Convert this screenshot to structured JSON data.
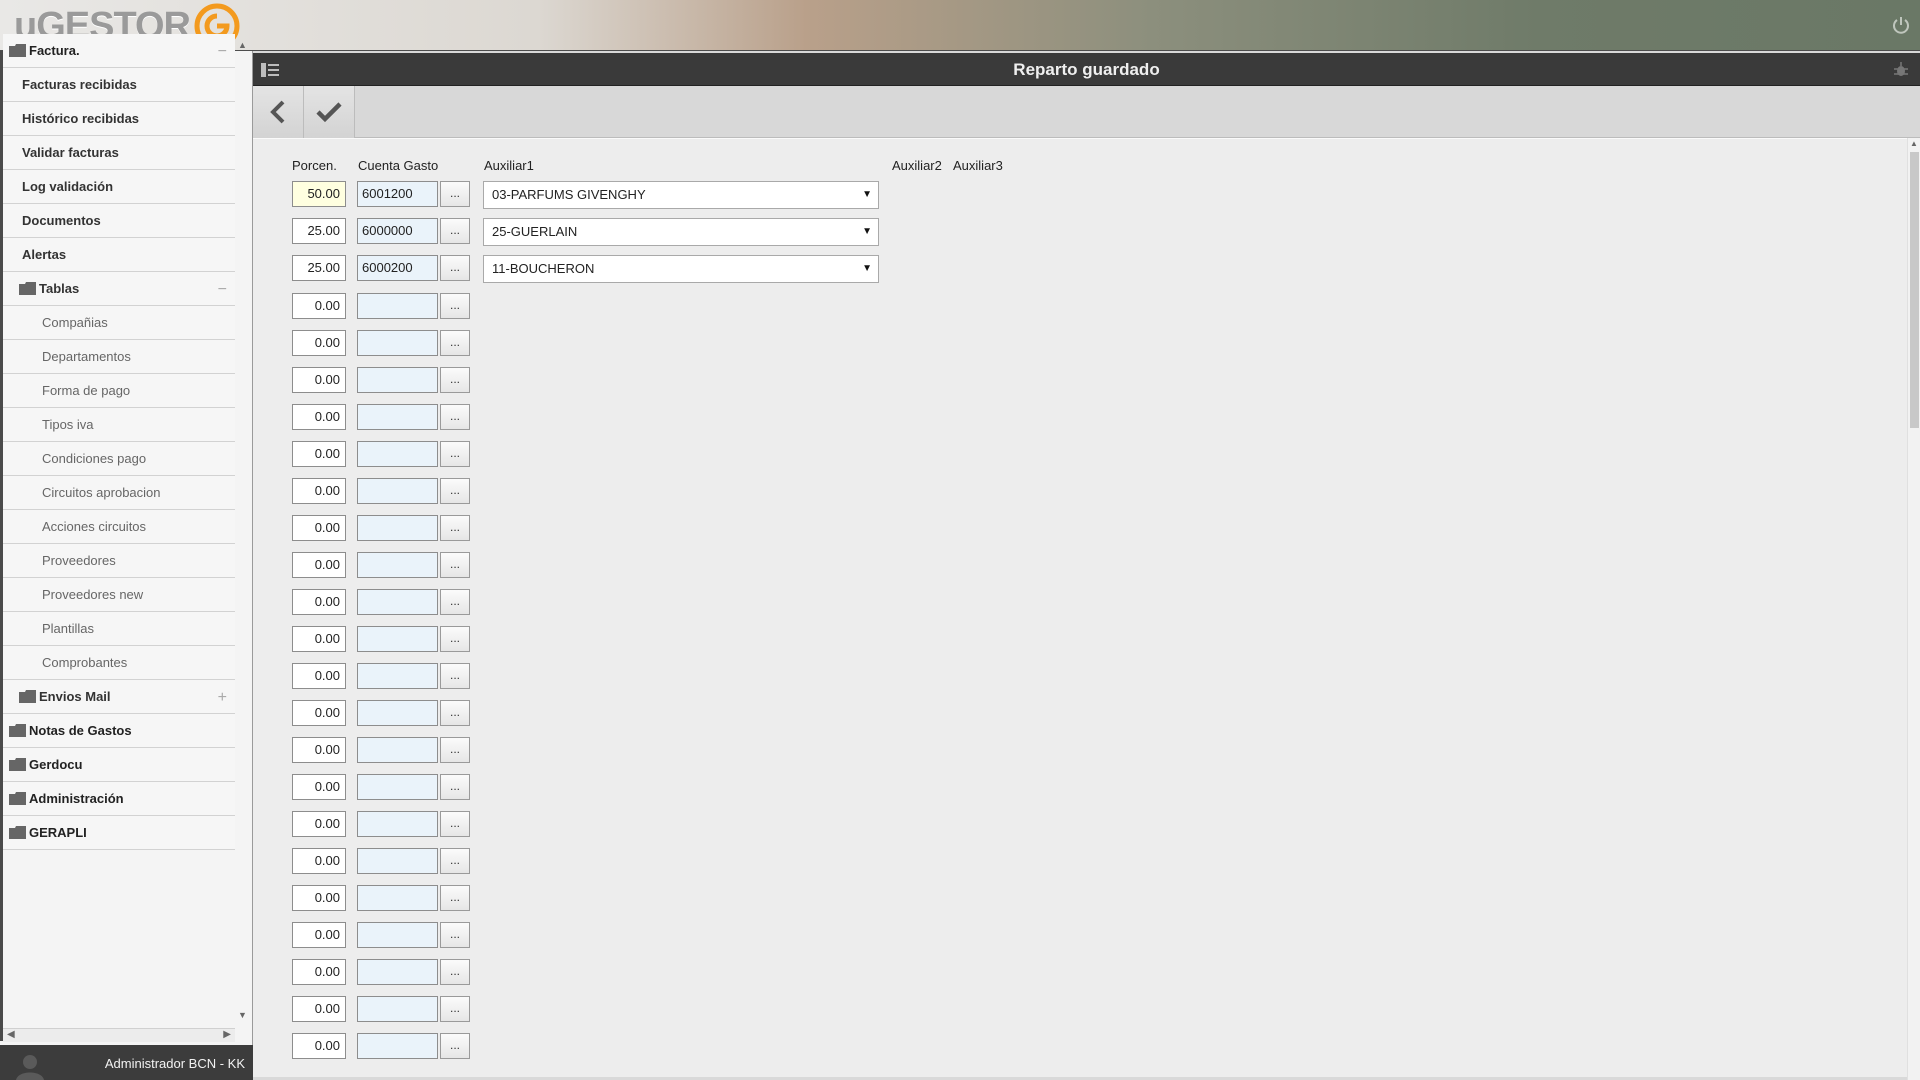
{
  "app": {
    "logo_text": "uGESTOR",
    "user_label": "Administrador BCN - KK"
  },
  "sidebar": {
    "items": [
      {
        "label": "Factura.",
        "level": 0,
        "folder": true,
        "toggle": "−"
      },
      {
        "label": "Facturas recibidas",
        "level": 1
      },
      {
        "label": "Histórico recibidas",
        "level": 1
      },
      {
        "label": "Validar facturas",
        "level": 1
      },
      {
        "label": "Log validación",
        "level": 1
      },
      {
        "label": "Documentos",
        "level": 1
      },
      {
        "label": "Alertas",
        "level": 1
      },
      {
        "label": "Tablas",
        "level": 1,
        "folder": true,
        "toggle": "−"
      },
      {
        "label": "Compañias",
        "level": 2
      },
      {
        "label": "Departamentos",
        "level": 2
      },
      {
        "label": "Forma de pago",
        "level": 2
      },
      {
        "label": "Tipos iva",
        "level": 2
      },
      {
        "label": "Condiciones pago",
        "level": 2
      },
      {
        "label": "Circuitos aprobacion",
        "level": 2
      },
      {
        "label": "Acciones circuitos",
        "level": 2
      },
      {
        "label": "Proveedores",
        "level": 2
      },
      {
        "label": "Proveedores new",
        "level": 2
      },
      {
        "label": "Plantillas",
        "level": 2
      },
      {
        "label": "Comprobantes",
        "level": 2
      },
      {
        "label": "Envios Mail",
        "level": 1,
        "folder": true,
        "toggle": "+"
      },
      {
        "label": "Notas de Gastos",
        "level": 0,
        "folder": true
      },
      {
        "label": "Gerdocu",
        "level": 0,
        "folder": true
      },
      {
        "label": "Administración",
        "level": 0,
        "folder": true
      },
      {
        "label": "GERAPLI",
        "level": 0,
        "folder": true
      }
    ]
  },
  "main": {
    "title": "Reparto guardado",
    "columns": {
      "porcen": "Porcen.",
      "cuenta": "Cuenta Gasto",
      "aux1": "Auxiliar1",
      "aux2": "Auxiliar2",
      "aux3": "Auxiliar3"
    },
    "lookup_label": "...",
    "rows": [
      {
        "pct": "50.00",
        "account": "6001200",
        "aux1": "03-PARFUMS GIVENGHY",
        "highlight": true
      },
      {
        "pct": "25.00",
        "account": "6000000",
        "aux1": "25-GUERLAIN"
      },
      {
        "pct": "25.00",
        "account": "6000200",
        "aux1": "11-BOUCHERON"
      },
      {
        "pct": "0.00",
        "account": ""
      },
      {
        "pct": "0.00",
        "account": ""
      },
      {
        "pct": "0.00",
        "account": ""
      },
      {
        "pct": "0.00",
        "account": ""
      },
      {
        "pct": "0.00",
        "account": ""
      },
      {
        "pct": "0.00",
        "account": ""
      },
      {
        "pct": "0.00",
        "account": ""
      },
      {
        "pct": "0.00",
        "account": ""
      },
      {
        "pct": "0.00",
        "account": ""
      },
      {
        "pct": "0.00",
        "account": ""
      },
      {
        "pct": "0.00",
        "account": ""
      },
      {
        "pct": "0.00",
        "account": ""
      },
      {
        "pct": "0.00",
        "account": ""
      },
      {
        "pct": "0.00",
        "account": ""
      },
      {
        "pct": "0.00",
        "account": ""
      },
      {
        "pct": "0.00",
        "account": ""
      },
      {
        "pct": "0.00",
        "account": ""
      },
      {
        "pct": "0.00",
        "account": ""
      },
      {
        "pct": "0.00",
        "account": ""
      },
      {
        "pct": "0.00",
        "account": ""
      },
      {
        "pct": "0.00",
        "account": ""
      }
    ]
  },
  "icons": {
    "logo": "ugestor-logo-icon",
    "power": "power-icon",
    "menu": "menu-icon",
    "bug": "bug-icon",
    "back": "back-arrow-icon",
    "save": "checkmark-icon",
    "folder": "folder-icon",
    "avatar": "user-avatar-icon"
  },
  "colors": {
    "accent": "#f39a1e",
    "title_bar": "#3a3a3a",
    "highlight_input": "#ffffe0",
    "account_input": "#eaf3fa"
  }
}
